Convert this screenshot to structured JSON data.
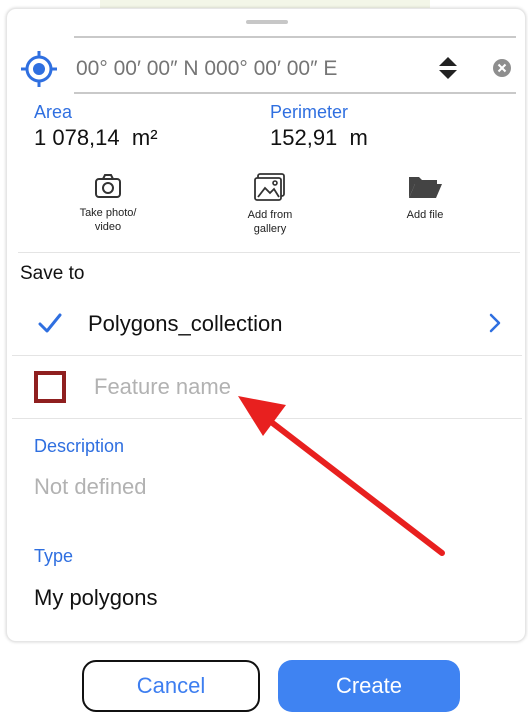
{
  "coordinates": {
    "placeholder": "00° 00′ 00″ N 000° 00′ 00″ E"
  },
  "metrics": {
    "area": {
      "label": "Area",
      "value": "1 078,14  m²"
    },
    "perimeter": {
      "label": "Perimeter",
      "value": "152,91  m"
    }
  },
  "actions": {
    "take_photo": {
      "label_line1": "Take photo/",
      "label_line2": "video",
      "icon": "camera-icon"
    },
    "add_gallery": {
      "label_line1": "Add from",
      "label_line2": "gallery",
      "icon": "gallery-icon"
    },
    "add_file": {
      "label_line1": "Add file",
      "icon": "folder-icon"
    }
  },
  "save_to": {
    "label": "Save to",
    "collection": "Polygons_collection"
  },
  "feature": {
    "placeholder": "Feature name",
    "checked": false
  },
  "description": {
    "label": "Description",
    "value": "Not defined"
  },
  "type": {
    "label": "Type",
    "value": "My polygons"
  },
  "buttons": {
    "cancel": "Cancel",
    "create": "Create"
  },
  "colors": {
    "accent": "#2f6fe0",
    "primary_button": "#3f83f2",
    "checkbox_border": "#8f1f1f",
    "annotation_arrow": "#e8201f"
  }
}
